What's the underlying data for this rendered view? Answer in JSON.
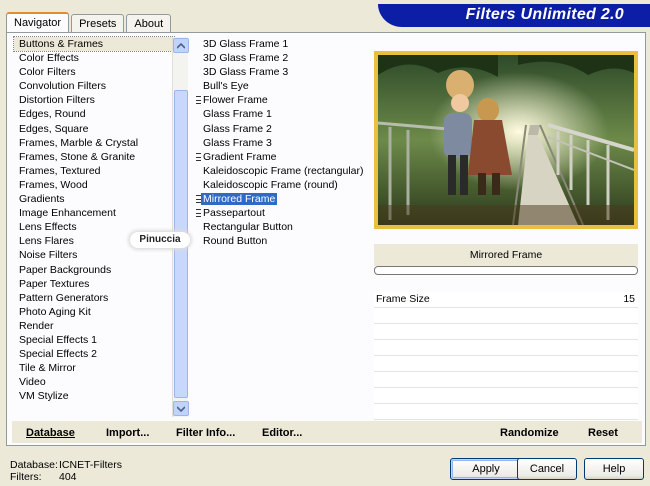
{
  "tabs": [
    {
      "label": "Navigator",
      "active": true
    },
    {
      "label": "Presets",
      "active": false
    },
    {
      "label": "About",
      "active": false
    }
  ],
  "banner_title": "Filters Unlimited 2.0",
  "categories": [
    "Buttons & Frames",
    "Color Effects",
    "Color Filters",
    "Convolution Filters",
    "Distortion Filters",
    "Edges, Round",
    "Edges, Square",
    "Frames, Marble & Crystal",
    "Frames, Stone & Granite",
    "Frames, Textured",
    "Frames, Wood",
    "Gradients",
    "Image Enhancement",
    "Lens Effects",
    "Lens Flares",
    "Noise Filters",
    "Paper Backgrounds",
    "Paper Textures",
    "Pattern Generators",
    "Photo Aging Kit",
    "Render",
    "Special Effects 1",
    "Special Effects 2",
    "Tile & Mirror",
    "Video",
    "VM Stylize"
  ],
  "selected_category": "Buttons & Frames",
  "filters": [
    {
      "label": "3D Glass Frame 1",
      "marked": false
    },
    {
      "label": "3D Glass Frame 2",
      "marked": false
    },
    {
      "label": "3D Glass Frame 3",
      "marked": false
    },
    {
      "label": "Bull's Eye",
      "marked": false
    },
    {
      "label": "Flower Frame",
      "marked": true
    },
    {
      "label": "Glass Frame 1",
      "marked": false
    },
    {
      "label": "Glass Frame 2",
      "marked": false
    },
    {
      "label": "Glass Frame 3",
      "marked": false
    },
    {
      "label": "Gradient Frame",
      "marked": true
    },
    {
      "label": "Kaleidoscopic Frame (rectangular)",
      "marked": false
    },
    {
      "label": "Kaleidoscopic Frame (round)",
      "marked": false
    },
    {
      "label": "Mirrored Frame",
      "marked": true
    },
    {
      "label": "Passepartout",
      "marked": true
    },
    {
      "label": "Rectangular Button",
      "marked": false
    },
    {
      "label": "Round Button",
      "marked": false
    }
  ],
  "selected_filter": "Mirrored Frame",
  "watermark": "Pinuccia",
  "preview_filter_name": "Mirrored Frame",
  "parameters": [
    {
      "name": "Frame Size",
      "value": "15"
    }
  ],
  "bottom_buttons": {
    "database": "Database",
    "import": "Import...",
    "filter_info": "Filter Info...",
    "editor": "Editor...",
    "randomize": "Randomize",
    "reset": "Reset"
  },
  "status": {
    "database_label": "Database:",
    "database_value": "ICNET-Filters",
    "filters_label": "Filters:",
    "filters_value": "404"
  },
  "dialog_buttons": {
    "apply": "Apply",
    "cancel": "Cancel",
    "help": "Help"
  },
  "colors": {
    "banner": "#0c1ea6",
    "selection": "#316ac5",
    "frame_gold": "#e8c040"
  }
}
